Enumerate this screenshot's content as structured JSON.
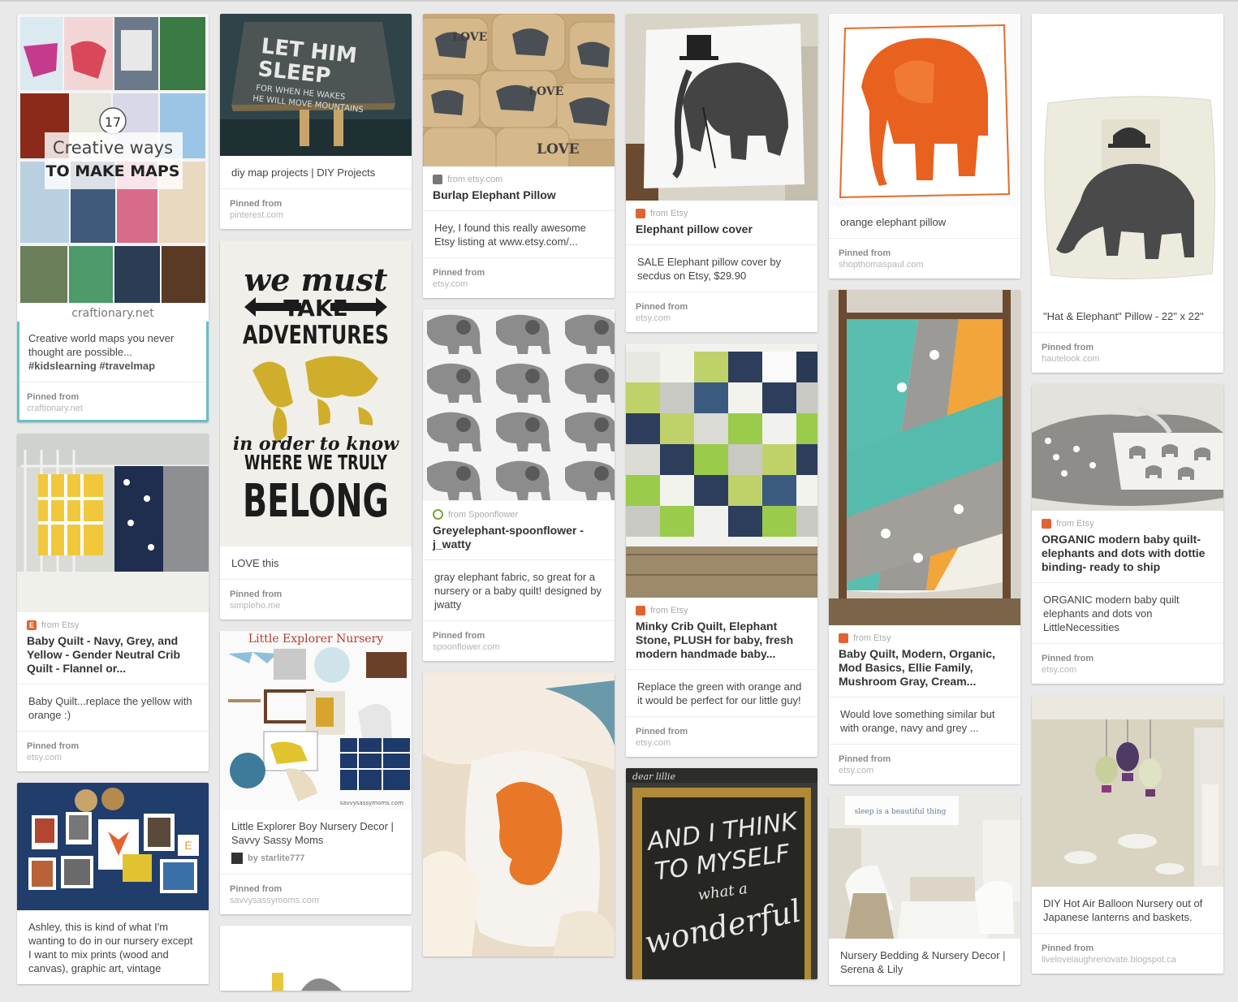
{
  "colors": {
    "background": "#e9e9e9",
    "card": "#ffffff",
    "selected_outline": "#66c0c7",
    "etsy_orange": "#e1632f"
  },
  "pinned_from_label": "Pinned from",
  "columns": [
    [
      {
        "image": "maps-collage",
        "image_text": {
          "number": "17",
          "line1": "Creative ways",
          "line2": "TO MAKE MAPS",
          "site": "craftionary.net"
        },
        "description": "Creative world maps you never thought are possible...",
        "tags": "#kidslearning #travelmap",
        "pinned_from": "craftionary.net"
      },
      {
        "image": "crib-quilt-yellow",
        "source_icon": "etsy-icon",
        "source": "from Etsy",
        "title": "Baby Quilt - Navy, Grey, and Yellow - Gender Neutral Crib Quilt - Flannel or...",
        "description": "Baby Quilt...replace the yellow with orange :)",
        "pinned_from": "etsy.com"
      },
      {
        "image": "nursery-wall-frames",
        "description": "Ashley, this is kind of what I'm wanting to do in our nursery except I want to mix prints (wood and canvas), graphic art, vintage"
      }
    ],
    [
      {
        "image": "let-him-sleep-sign",
        "image_text": {
          "line1": "LET HIM",
          "line2": "SLEEP",
          "line3": "FOR WHEN HE WAKES",
          "line4": "HE WILL MOVE MOUNTAINS"
        },
        "description": "diy map projects | DIY Projects",
        "pinned_from": "pinterest.com"
      },
      {
        "image": "adventures-poster",
        "image_text": {
          "line1": "we must",
          "line2": "TAKE",
          "line3": "ADVENTURES",
          "line4": "in order to know",
          "line5": "WHERE WE TRULY",
          "line6": "BELONG"
        },
        "description": "LOVE this",
        "pinned_from": "simpleho.me"
      },
      {
        "image": "explorer-nursery-board",
        "image_text": {
          "title": "Little Explorer Nursery",
          "site": "savvysassymoms.com"
        },
        "description": "Little Explorer Boy Nursery Decor | Savvy Sassy Moms",
        "by": "by starlite777",
        "pinned_from": "savvysassymoms.com"
      },
      {
        "image": "partial-yellow"
      }
    ],
    [
      {
        "image": "burlap-elephant-pillows",
        "image_text": {
          "word": "LOVE"
        },
        "source_icon": "generic-pin-icon",
        "source": "from etsy.com",
        "title": "Burlap Elephant Pillow",
        "description": "Hey, I found this really awesome Etsy listing at www.etsy.com/...",
        "pinned_from": "etsy.com"
      },
      {
        "image": "grey-elephant-fabric",
        "source_icon": "spoonflower-icon",
        "source": "from Spoonflower",
        "title": "Greyelephant-spoonflower - j_watty",
        "description": "gray elephant fabric, so great for a nursery or a baby quilt! designed by jwatty",
        "pinned_from": "spoonflower.com"
      },
      {
        "image": "orange-elephant-pillow-closeup",
        "description": ""
      }
    ],
    [
      {
        "image": "tophat-elephant-pillow",
        "source_icon": "etsy-icon",
        "source": "from Etsy",
        "title": "Elephant pillow cover",
        "description": "SALE Elephant pillow cover by secdus on Etsy, $29.90",
        "pinned_from": "etsy.com"
      },
      {
        "image": "minky-crib-quilt",
        "source_icon": "etsy-icon",
        "source": "from Etsy",
        "title": "Minky Crib Quilt, Elephant Stone, PLUSH for baby, fresh modern handmade baby...",
        "description": "Replace the green with orange and it would be perfect for our little guy!",
        "pinned_from": "etsy.com"
      },
      {
        "image": "chalkboard-wonderful",
        "image_text": {
          "top": "dear lillie",
          "line1": "AND I THINK",
          "line2": "TO MYSELF",
          "line3": "what a",
          "line4": "wonderful"
        }
      }
    ],
    [
      {
        "image": "orange-elephant-pillow",
        "description": "orange elephant pillow",
        "pinned_from": "shopthomaspaul.com"
      },
      {
        "image": "elephant-quilt-ladder",
        "source_icon": "etsy-icon",
        "source": "from Etsy",
        "title": "Baby Quilt, Modern, Organic, Mod Basics, Ellie Family, Mushroom Gray, Cream...",
        "description": "Would love something similar but with orange, navy and grey ...",
        "pinned_from": "etsy.com"
      },
      {
        "image": "white-nursery-room",
        "image_text": {
          "banner": "sleep is a beautiful thing"
        },
        "description": "Nursery Bedding & Nursery Decor | Serena & Lily"
      }
    ],
    [
      {
        "image": "hat-elephant-pillow",
        "description": "\"Hat & Elephant\" Pillow - 22\" x 22\"",
        "pinned_from": "hautelook.com"
      },
      {
        "image": "organic-baby-quilt-roll",
        "source_icon": "etsy-icon",
        "source": "from Etsy",
        "title": "ORGANIC modern baby quilt- elephants and dots with dottie binding- ready to ship",
        "description": "ORGANIC modern baby quilt elephants and dots von LittleNecessities",
        "pinned_from": "etsy.com"
      },
      {
        "image": "hot-air-balloon-nursery",
        "description": "DIY Hot Air Balloon Nursery out of Japanese lanterns and baskets.",
        "pinned_from": "livelovelaughrenovate.blogspot.ca"
      }
    ]
  ]
}
